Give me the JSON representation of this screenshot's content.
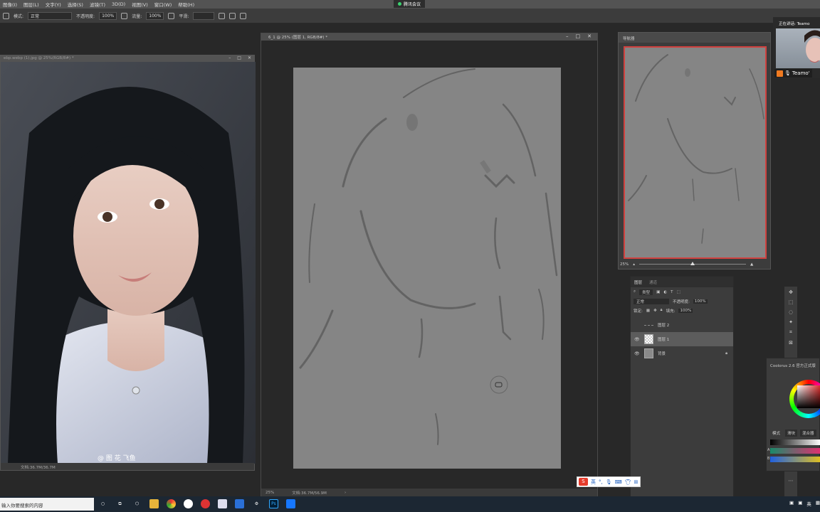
{
  "menubar": {
    "items": [
      "图像(I)",
      "图层(L)",
      "文字(Y)",
      "选择(S)",
      "滤镜(T)",
      "3D(D)",
      "视图(V)",
      "窗口(W)",
      "帮助(H)"
    ],
    "meeting_label": "腾讯会议"
  },
  "options_bar": {
    "mode_label": "模式:",
    "mode_value": "正常",
    "opacity_label": "不透明度:",
    "opacity_value": "100%",
    "flow_label": "流量:",
    "flow_value": "100%",
    "smoothing_label": "平滑:"
  },
  "photo_window": {
    "title": "ebp.webp (1).jpg @ 25%(RGB/8#) *",
    "status": "文档:36.7M/36.7M",
    "watermark": "@ 图 花 飞鱼"
  },
  "canvas_window": {
    "title": "6_1 @ 25% (图层 1, RGB/8#) *",
    "zoom": "25%",
    "doc_size": "文档:36.7M/56.9M"
  },
  "navigator": {
    "title": "导航器",
    "zoom": "25%",
    "zoom_level": 0.5
  },
  "layers_panel": {
    "tabs": [
      "图层",
      "通道"
    ],
    "filter_label": "类型",
    "blend_mode": "正常",
    "opacity_label": "不透明度:",
    "opacity_value": "100%",
    "lock_label": "锁定:",
    "fill_label": "填充:",
    "fill_value": "100%",
    "layers": [
      {
        "name": "图层 2",
        "visible": false,
        "selected": false
      },
      {
        "name": "图层 1",
        "visible": true,
        "selected": true
      },
      {
        "name": "背景",
        "visible": true,
        "selected": false
      }
    ]
  },
  "coolorus": {
    "title": "Coolorus 2.6 官方正式版",
    "mode_label": "模式",
    "btn_mix": "滑块",
    "btn_mixer": "混合器",
    "bar_labels": [
      "",
      "A",
      "B"
    ]
  },
  "video_call": {
    "speaking": "正在讲话: Teamo",
    "name": "Teamo'"
  },
  "ime": {
    "lang": "英"
  },
  "taskbar": {
    "search_placeholder": "输入你要搜索的内容",
    "tray_text": "英"
  },
  "colors": {
    "accent_red": "#d0413f",
    "canvas_gray": "#858585",
    "panel_bg": "#3c3c3c"
  }
}
